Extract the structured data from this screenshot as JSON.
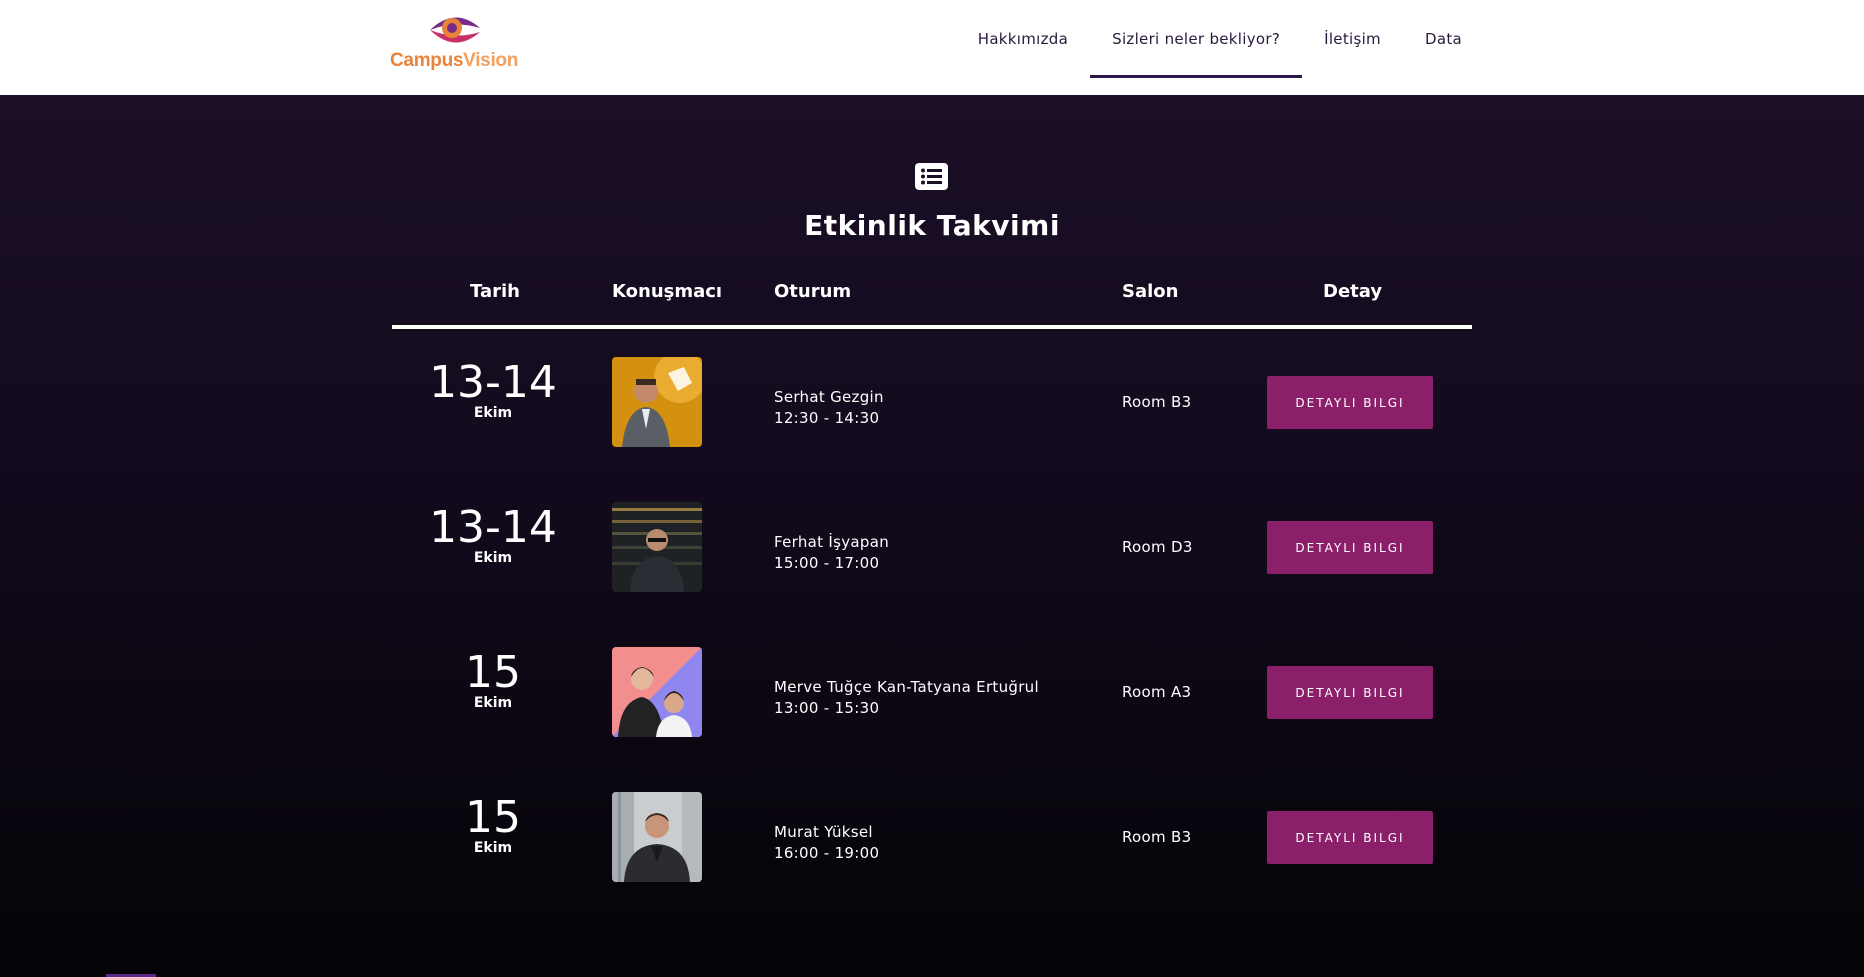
{
  "brand": {
    "logo_part1": "Campus",
    "logo_part2": "Vision"
  },
  "nav": {
    "items": [
      {
        "label": "Hakkımızda"
      },
      {
        "label": "Sizleri neler bekliyor?"
      },
      {
        "label": "İletişim"
      },
      {
        "label": "Data"
      }
    ],
    "active_index": 1
  },
  "section": {
    "icon": "list-icon",
    "title": "Etkinlik Takvimi"
  },
  "table": {
    "headers": {
      "date": "Tarih",
      "speaker": "Konuşmacı",
      "session": "Oturum",
      "room": "Salon",
      "detail": "Detay"
    },
    "rows": [
      {
        "date": "13-14",
        "month": "Ekim",
        "speaker": "Serhat Gezgin",
        "time": "12:30 - 14:30",
        "room": "Room B3",
        "button": "DETAYLI BILGI"
      },
      {
        "date": "13-14",
        "month": "Ekim",
        "speaker": "Ferhat İşyapan",
        "time": "15:00 - 17:00",
        "room": "Room D3",
        "button": "DETAYLI BILGI"
      },
      {
        "date": "15",
        "month": "Ekim",
        "speaker": "Merve Tuğçe Kan-Tatyana Ertuğrul",
        "time": "13:00 - 15:30",
        "room": "Room A3",
        "button": "DETAYLI BILGI"
      },
      {
        "date": "15",
        "month": "Ekim",
        "speaker": "Murat Yüksel",
        "time": "16:00 - 19:00",
        "room": "Room B3",
        "button": "DETAYLI BILGI"
      }
    ]
  },
  "colors": {
    "accent_button": "#8c1f6a",
    "header_bg": "#ffffff",
    "nav_text": "#2a1a3e",
    "logo_orange": "#e8833a",
    "logo_purple": "#7a2a8a"
  }
}
